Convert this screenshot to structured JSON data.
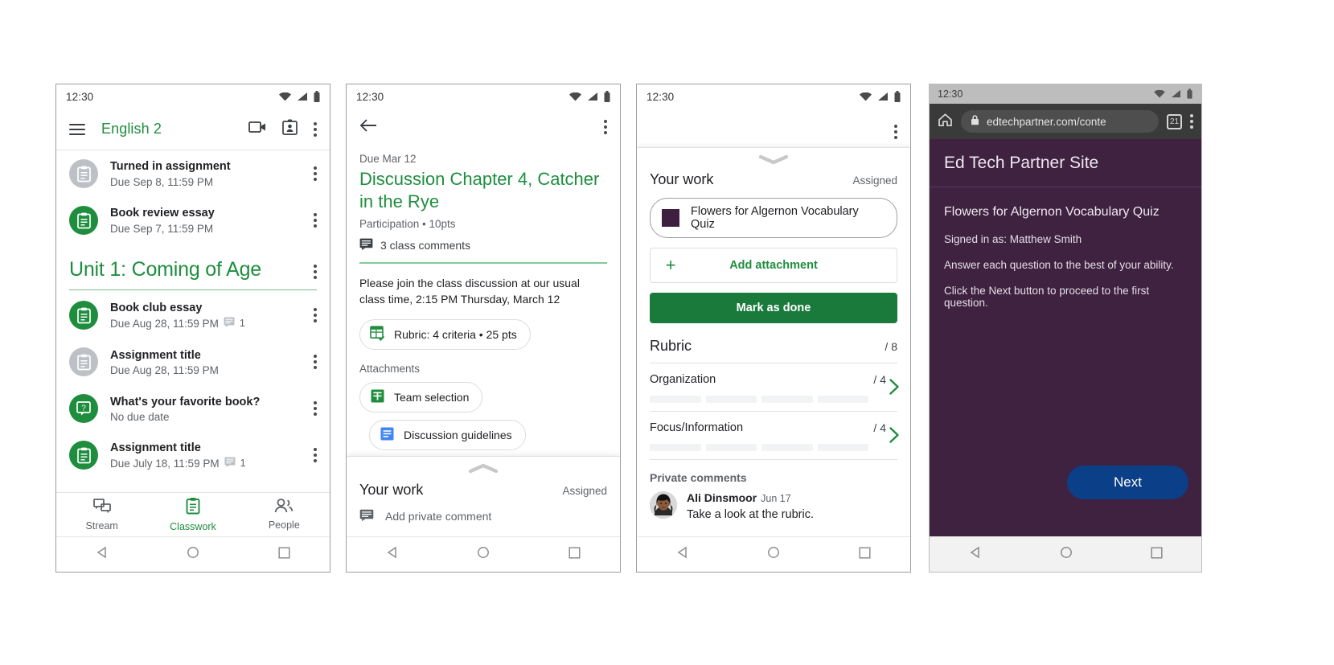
{
  "phone1": {
    "status": {
      "time": "12:30"
    },
    "appbar": {
      "title": "English 2",
      "menu_icon": "hamburger-icon",
      "meet_icon": "video-camera-icon",
      "roster_icon": "contact-card-icon",
      "overflow_icon": "kebab-icon"
    },
    "top_items": [
      {
        "title": "Turned in assignment",
        "sub": "Due Sep 8, 11:59 PM",
        "icon": "assignment-icon",
        "state": "grey",
        "comments": ""
      },
      {
        "title": "Book review essay",
        "sub": "Due Sep 7, 11:59 PM",
        "icon": "assignment-icon",
        "state": "green",
        "comments": ""
      }
    ],
    "unit": {
      "title": "Unit 1: Coming of Age"
    },
    "unit_items": [
      {
        "title": "Book club essay",
        "sub": "Due Aug 28, 11:59 PM",
        "icon": "assignment-icon",
        "state": "green",
        "comments": "1"
      },
      {
        "title": "Assignment title",
        "sub": "Due Aug 28, 11:59 PM",
        "icon": "assignment-icon",
        "state": "grey",
        "comments": ""
      },
      {
        "title": "What's your favorite book?",
        "sub": "No due date",
        "icon": "question-icon",
        "state": "green",
        "comments": ""
      },
      {
        "title": "Assignment title",
        "sub": "Due July 18, 11:59 PM",
        "icon": "assignment-icon",
        "state": "green",
        "comments": "1"
      }
    ],
    "bottom_nav": [
      {
        "label": "Stream",
        "icon": "stream-icon",
        "active": false
      },
      {
        "label": "Classwork",
        "icon": "classwork-icon",
        "active": true
      },
      {
        "label": "People",
        "icon": "people-icon",
        "active": false
      }
    ]
  },
  "phone2": {
    "status": {
      "time": "12:30"
    },
    "back_icon": "back-arrow-icon",
    "overflow_icon": "kebab-icon",
    "due": "Due Mar 12",
    "title": "Discussion Chapter 4, Catcher in the Rye",
    "meta": "Participation • 10pts",
    "comments": "3 class comments",
    "body": "Please join the class discussion at our usual class time, 2:15 PM Thursday, March 12",
    "rubric_chip": {
      "label": "Rubric: 4 criteria • 25 pts",
      "icon": "rubric-icon"
    },
    "attachments_label": "Attachments",
    "attachments": [
      {
        "label": "Team selection",
        "icon": "google-sheets-icon"
      },
      {
        "label": "Discussion guidelines",
        "icon": "google-docs-icon"
      }
    ],
    "sheet": {
      "title": "Your work",
      "status": "Assigned",
      "private_comment_placeholder": "Add private comment",
      "comment_icon": "comment-icon",
      "grabber_icon": "chevron-up-icon"
    }
  },
  "phone3": {
    "status": {
      "time": "12:30"
    },
    "overflow_icon": "kebab-icon",
    "grabber_icon": "chevron-down-icon",
    "yourwork": {
      "title": "Your work",
      "status": "Assigned"
    },
    "attachment": {
      "label": "Flowers for Algernon Vocabulary Quiz",
      "icon": "quiz-thumbnail-icon",
      "color": "#3f1f3f"
    },
    "add_attachment": {
      "label": "Add attachment",
      "icon": "plus-icon"
    },
    "mark_as_done": {
      "label": "Mark as done",
      "color": "#1a7a3c"
    },
    "rubric": {
      "title": "Rubric",
      "total": "/ 8",
      "criteria": [
        {
          "name": "Organization",
          "score": "/ 4",
          "levels": 4,
          "chevron": "chevron-right-icon"
        },
        {
          "name": "Focus/Information",
          "score": "/ 4",
          "levels": 4,
          "chevron": "chevron-right-icon"
        }
      ]
    },
    "private_comments": {
      "heading": "Private comments",
      "items": [
        {
          "author": "Ali Dinsmoor",
          "date": "Jun 17",
          "text": "Take a look at the rubric.",
          "avatar": "user-avatar"
        }
      ]
    }
  },
  "phone4": {
    "status": {
      "time": "12:30"
    },
    "chrome": {
      "home_icon": "home-icon",
      "lock_icon": "lock-icon",
      "url": "edtechpartner.com/conte",
      "tab_count": "21",
      "overflow_icon": "kebab-icon"
    },
    "page": {
      "site_title": "Ed Tech Partner Site",
      "quiz_title": "Flowers for Algernon Vocabulary Quiz",
      "lines": [
        "Signed in as: Matthew Smith",
        "Answer each question to the best of your ability.",
        "Click the Next button to proceed to the first question."
      ],
      "next_label": "Next",
      "bg_color": "#3e2240",
      "next_color": "#0b3f87"
    }
  }
}
